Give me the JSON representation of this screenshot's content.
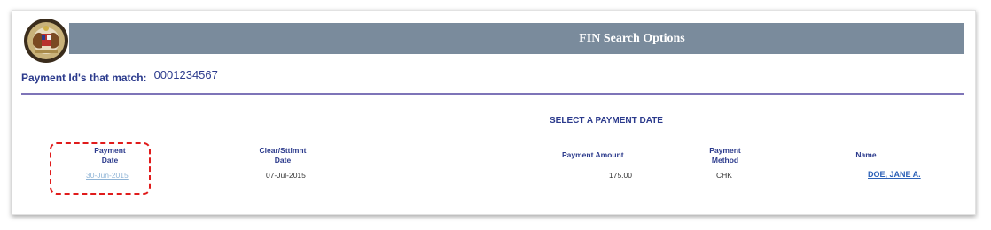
{
  "header": {
    "title": "FIN Search Options"
  },
  "match": {
    "label": "Payment Id's that match:",
    "value": "0001234567"
  },
  "section_title": "SELECT A PAYMENT DATE",
  "table": {
    "columns": [
      {
        "line1": "Payment",
        "line2": "Date"
      },
      {
        "line1": "Clear/Sttlmnt",
        "line2": "Date"
      },
      {
        "line1": "Payment Amount",
        "line2": ""
      },
      {
        "line1": "Payment",
        "line2": "Method"
      },
      {
        "line1": "Name",
        "line2": ""
      }
    ],
    "rows": [
      {
        "payment_date": "30-Jun-2015",
        "clear_date": "07-Jul-2015",
        "amount": "175.00",
        "method": "CHK",
        "name": "DOE, JANE A."
      }
    ]
  },
  "colors": {
    "title_bar": "#7a8b9c",
    "label_text": "#2b3a8c",
    "divider": "#7e74b8",
    "highlight": "#e01b1b",
    "link": "#2d62b8"
  },
  "icons": {
    "seal": "state-seal-icon"
  }
}
